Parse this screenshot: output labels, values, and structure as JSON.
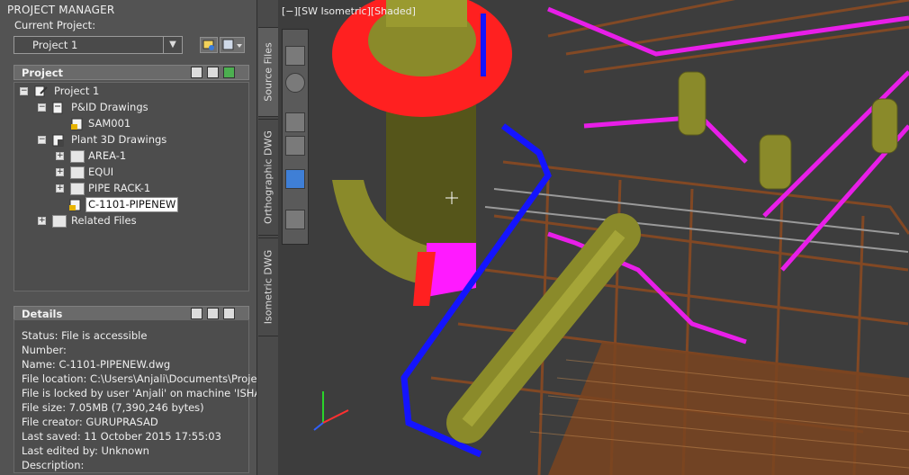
{
  "palette": {
    "title": "PROJECT MANAGER",
    "current_project_label": "Current Project:",
    "current_project_value": "Project 1"
  },
  "tree_section": {
    "header": "Project",
    "nodes": [
      {
        "label": "Project 1",
        "icon": "project-icon"
      },
      {
        "label": "P&ID Drawings",
        "icon": "pid-drawings-icon"
      },
      {
        "label": "SAM001",
        "icon": "locked-drawing-icon"
      },
      {
        "label": "Plant 3D Drawings",
        "icon": "plant3d-icon"
      },
      {
        "label": "AREA-1",
        "icon": "folder-icon"
      },
      {
        "label": "EQUI",
        "icon": "folder-icon"
      },
      {
        "label": "PIPE RACK-1",
        "icon": "folder-icon"
      },
      {
        "label": "C-1101-PIPENEW",
        "icon": "locked-drawing-icon"
      },
      {
        "label": "Related Files",
        "icon": "folder-icon"
      }
    ]
  },
  "details": {
    "header": "Details",
    "lines": [
      "Status: File is accessible",
      "Number:",
      "Name: C-1101-PIPENEW.dwg",
      "File location: C:\\Users\\Anjali\\Documents\\Projec",
      "File is locked by user 'Anjali' on machine 'ISHAI",
      "File size: 7.05MB (7,390,246 bytes)",
      "File creator: GURUPRASAD",
      "Last saved: 11 October 2015 17:55:03",
      "Last edited by: Unknown",
      "Description:"
    ]
  },
  "vertical_tabs": [
    "Source Files",
    "Orthographic DWG",
    "Isometric DWG"
  ],
  "viewport": {
    "label": "[−][SW Isometric][Shaded]",
    "nav_icons": [
      "viewcube-icon",
      "steering-wheel-icon",
      "pan-hand-icon",
      "zoom-icon",
      "orbit-icon",
      "showmotion-icon"
    ]
  },
  "colors": {
    "accent_red": "#ff2020",
    "pipe_blue": "#1414ff",
    "pipe_magenta": "#e81ee8",
    "steel_olive": "#8a8a2a",
    "structure_brown": "#8a4a22"
  }
}
